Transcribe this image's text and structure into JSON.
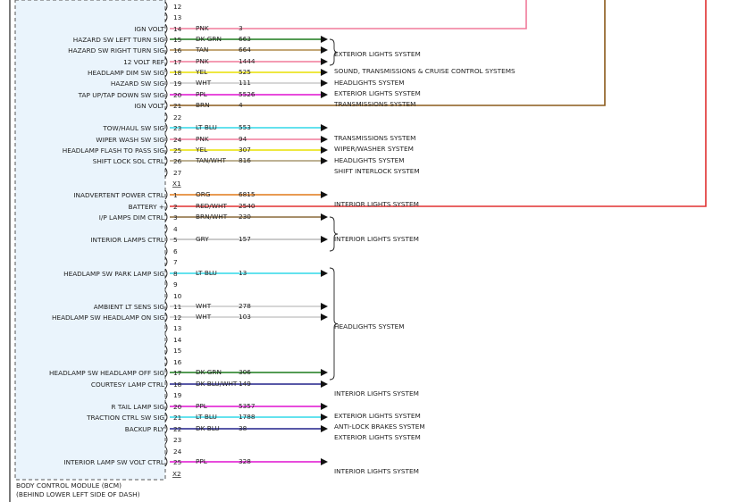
{
  "module": {
    "name": "BODY CONTROL MODULE (BCM)",
    "location": "(BEHIND LOWER LEFT SIDE OF DASH)",
    "connector_labels": [
      "X1",
      "X2"
    ]
  },
  "pins_x1": [
    {
      "num": "12",
      "label": "",
      "color": "",
      "circuit": "",
      "wire": "",
      "arrow": false
    },
    {
      "num": "13",
      "label": "",
      "color": "",
      "circuit": "",
      "wire": "",
      "arrow": false
    },
    {
      "num": "14",
      "label": "IGN VOLT",
      "color": "PNK",
      "circuit": "3",
      "wire": "#f07a9a",
      "arrow": false
    },
    {
      "num": "15",
      "label": "HAZARD SW LEFT TURN SIG",
      "color": "DK GRN",
      "circuit": "663",
      "wire": "#1a7a1a",
      "arrow": true
    },
    {
      "num": "16",
      "label": "HAZARD SW RIGHT TURN SIG",
      "color": "TAN",
      "circuit": "664",
      "wire": "#b08a4a",
      "arrow": true
    },
    {
      "num": "17",
      "label": "12 VOLT REF",
      "color": "PNK",
      "circuit": "1444",
      "wire": "#f07a9a",
      "arrow": true
    },
    {
      "num": "18",
      "label": "HEADLAMP DIM SW SIG",
      "color": "YEL",
      "circuit": "525",
      "wire": "#e8e000",
      "arrow": true
    },
    {
      "num": "19",
      "label": "HAZARD SW SIG",
      "color": "WHT",
      "circuit": "111",
      "wire": "#c8c8c8",
      "arrow": true
    },
    {
      "num": "20",
      "label": "TAP UP/TAP DOWN SW SIG",
      "color": "PPL",
      "circuit": "5526",
      "wire": "#e010d0",
      "arrow": true
    },
    {
      "num": "21",
      "label": "IGN VOLT",
      "color": "BRN",
      "circuit": "4",
      "wire": "#8a5a1a",
      "arrow": false
    },
    {
      "num": "22",
      "label": "",
      "color": "",
      "circuit": "",
      "wire": "",
      "arrow": false
    },
    {
      "num": "23",
      "label": "TOW/HAUL SW SIG",
      "color": "LT BLU",
      "circuit": "553",
      "wire": "#30d8e8",
      "arrow": true
    },
    {
      "num": "24",
      "label": "WIPER WASH SW SIG",
      "color": "PNK",
      "circuit": "94",
      "wire": "#f07a9a",
      "arrow": true
    },
    {
      "num": "25",
      "label": "HEADLAMP FLASH TO PASS SIG",
      "color": "YEL",
      "circuit": "307",
      "wire": "#e8e000",
      "arrow": true
    },
    {
      "num": "26",
      "label": "SHIFT LOCK SOL CTRL",
      "color": "TAN/WHT",
      "circuit": "816",
      "wire": "#a89870",
      "arrow": true
    },
    {
      "num": "27",
      "label": "",
      "color": "",
      "circuit": "",
      "wire": "",
      "arrow": false
    }
  ],
  "pins_x2": [
    {
      "num": "1",
      "label": "INADVERTENT POWER CTRL",
      "color": "ORG",
      "circuit": "6815",
      "wire": "#e07818",
      "arrow": true
    },
    {
      "num": "2",
      "label": "BATTERY +",
      "color": "RED/WHT",
      "circuit": "2540",
      "wire": "#e03030",
      "arrow": false
    },
    {
      "num": "3",
      "label": "I/P LAMPS DIM CTRL",
      "color": "BRN/WHT",
      "circuit": "230",
      "wire": "#8a6a3a",
      "arrow": true
    },
    {
      "num": "4",
      "label": "",
      "color": "",
      "circuit": "",
      "wire": "",
      "arrow": false
    },
    {
      "num": "5",
      "label": "INTERIOR LAMPS CTRL",
      "color": "GRY",
      "circuit": "157",
      "wire": "#b8b8b8",
      "arrow": true
    },
    {
      "num": "6",
      "label": "",
      "color": "",
      "circuit": "",
      "wire": "",
      "arrow": false
    },
    {
      "num": "7",
      "label": "",
      "color": "",
      "circuit": "",
      "wire": "",
      "arrow": false
    },
    {
      "num": "8",
      "label": "HEADLAMP SW PARK LAMP SIG",
      "color": "LT BLU",
      "circuit": "13",
      "wire": "#30d8e8",
      "arrow": true
    },
    {
      "num": "9",
      "label": "",
      "color": "",
      "circuit": "",
      "wire": "",
      "arrow": false
    },
    {
      "num": "10",
      "label": "",
      "color": "",
      "circuit": "",
      "wire": "",
      "arrow": false
    },
    {
      "num": "11",
      "label": "AMBIENT LT SENS SIG",
      "color": "WHT",
      "circuit": "278",
      "wire": "#c8c8c8",
      "arrow": true
    },
    {
      "num": "12",
      "label": "HEADLAMP SW HEADLAMP ON SIG",
      "color": "WHT",
      "circuit": "103",
      "wire": "#c8c8c8",
      "arrow": true
    },
    {
      "num": "13",
      "label": "",
      "color": "",
      "circuit": "",
      "wire": "",
      "arrow": false
    },
    {
      "num": "14",
      "label": "",
      "color": "",
      "circuit": "",
      "wire": "",
      "arrow": false
    },
    {
      "num": "15",
      "label": "",
      "color": "",
      "circuit": "",
      "wire": "",
      "arrow": false
    },
    {
      "num": "16",
      "label": "",
      "color": "",
      "circuit": "",
      "wire": "",
      "arrow": false
    },
    {
      "num": "17",
      "label": "HEADLAMP SW HEADLAMP OFF SIG",
      "color": "DK GRN",
      "circuit": "306",
      "wire": "#1a7a1a",
      "arrow": true
    },
    {
      "num": "18",
      "label": "COURTESY LAMP CTRL",
      "color": "DK BLU/WHT",
      "circuit": "149",
      "wire": "#20208a",
      "arrow": true
    },
    {
      "num": "19",
      "label": "",
      "color": "",
      "circuit": "",
      "wire": "",
      "arrow": false
    },
    {
      "num": "20",
      "label": "R TAIL LAMP SIG",
      "color": "PPL",
      "circuit": "5357",
      "wire": "#e010d0",
      "arrow": true
    },
    {
      "num": "21",
      "label": "TRACTION CTRL SW SIG",
      "color": "LT BLU",
      "circuit": "1788",
      "wire": "#30d8e8",
      "arrow": true
    },
    {
      "num": "22",
      "label": "BACKUP RLY",
      "color": "DK BLU",
      "circuit": "38",
      "wire": "#20208a",
      "arrow": true
    },
    {
      "num": "23",
      "label": "",
      "color": "",
      "circuit": "",
      "wire": "",
      "arrow": false
    },
    {
      "num": "24",
      "label": "",
      "color": "",
      "circuit": "",
      "wire": "",
      "arrow": false
    },
    {
      "num": "25",
      "label": "INTERIOR LAMP SW VOLT CTRL",
      "color": "PPL",
      "circuit": "328",
      "wire": "#e010d0",
      "arrow": true
    }
  ],
  "systems": [
    "EXTERIOR LIGHTS SYSTEM",
    "SOUND, TRANSMISSIONS & CRUISE CONTROL SYSTEMS",
    "HEADLIGHTS SYSTEM",
    "EXTERIOR LIGHTS SYSTEM",
    "TRANSMISSIONS SYSTEM",
    "TRANSMISSIONS SYSTEM",
    "WIPER/WASHER SYSTEM",
    "HEADLIGHTS SYSTEM",
    "SHIFT INTERLOCK SYSTEM",
    "INTERIOR LIGHTS SYSTEM",
    "INTERIOR LIGHTS SYSTEM",
    "HEADLIGHTS SYSTEM",
    "INTERIOR LIGHTS SYSTEM",
    "EXTERIOR LIGHTS SYSTEM",
    "ANTI-LOCK BRAKES SYSTEM",
    "EXTERIOR LIGHTS SYSTEM",
    "INTERIOR LIGHTS SYSTEM"
  ]
}
